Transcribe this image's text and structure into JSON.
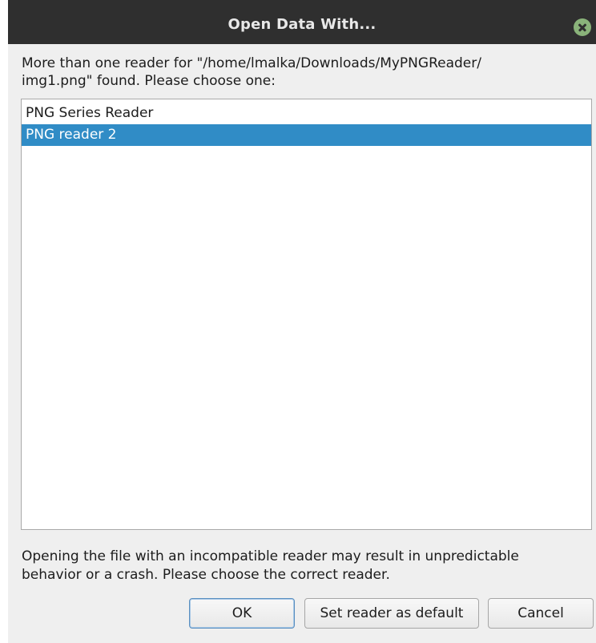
{
  "window": {
    "title": "Open Data With..."
  },
  "message": {
    "line1": "More than one reader for \"/home/lmalka/Downloads/MyPNGReader/",
    "line2": "img1.png\" found. Please choose one:"
  },
  "readers": [
    {
      "label": "PNG Series Reader",
      "selected": false
    },
    {
      "label": "PNG reader 2",
      "selected": true
    }
  ],
  "warning": {
    "line1": "Opening the file with an incompatible reader may result in unpredictable",
    "line2": "behavior or a crash.  Please choose the correct reader."
  },
  "buttons": {
    "ok": "OK",
    "set_default": "Set reader as default",
    "cancel": "Cancel"
  },
  "colors": {
    "selection": "#308cc6",
    "titlebar": "#2f2f2f",
    "close_icon": "#8ab37a"
  }
}
